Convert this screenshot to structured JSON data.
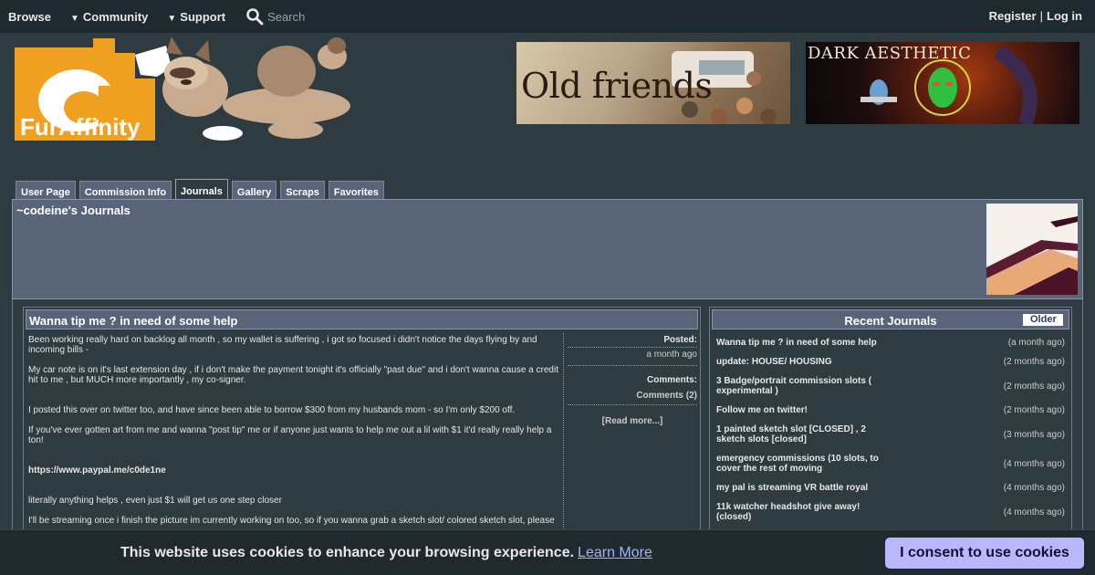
{
  "topnav": {
    "browse": "Browse",
    "community": "Community",
    "support": "Support",
    "search_placeholder": "Search",
    "register": "Register",
    "separator": "|",
    "login": "Log in"
  },
  "header": {
    "logo_text": "FurAffinity",
    "ad1_text": "Old friends",
    "ad2_text": "DARK AESTHETIC"
  },
  "tabs": [
    "User Page",
    "Commission Info",
    "Journals",
    "Gallery",
    "Scraps",
    "Favorites"
  ],
  "active_tab": "Journals",
  "user": {
    "title": "~codeine's Journals"
  },
  "journal": {
    "title": "Wanna tip me ? in need of some help",
    "paragraphs": [
      "Been working really hard on backlog all month , so my wallet is suffering , i got so focused i didn't notice the days flying by and incoming bills -",
      "My car note is on it's last extension day , if i don't make the payment tonight it's officially \"past due\" and i don't wanna cause a credit hit to me , but MUCH more importantly , my co-signer.",
      "I posted this over on twitter too, and have since been able to borrow $300 from my husbands mom - so I'm only $200 off.",
      "If you've ever gotten art from me and wanna \"post tip\" me or if anyone just wants to help me out a lil with $1 it'd really really help a ton!",
      "https://www.paypal.me/c0de1ne",
      "literally anything helps , even just $1 will get us one step closer",
      "I'll be streaming once i finish the picture im currently working on too, so if you wanna grab a sketch slot/ colored sketch slot, please"
    ],
    "posted_label": "Posted:",
    "posted_value": "a month ago",
    "comments_label": "Comments:",
    "comments_value": "Comments (2)",
    "read_more": "[Read more...]"
  },
  "recent": {
    "title": "Recent Journals",
    "older": "Older",
    "items": [
      {
        "title": "Wanna tip me ? in need of some help",
        "date": "(a month ago)"
      },
      {
        "title": "update: HOUSE/ HOUSING",
        "date": "(2 months ago)"
      },
      {
        "title": "3 Badge/portrait commission slots ( experimental )",
        "date": "(2 months ago)"
      },
      {
        "title": "Follow me on twitter!",
        "date": "(2 months ago)"
      },
      {
        "title": "1 painted sketch slot [CLOSED] , 2 sketch slots [closed]",
        "date": "(3 months ago)"
      },
      {
        "title": "emergency commissions (10 slots, to cover the rest of moving",
        "date": "(4 months ago)"
      },
      {
        "title": "my pal is streaming VR battle royal",
        "date": "(4 months ago)"
      },
      {
        "title": "11k watcher headshot give away! (closed)",
        "date": "(4 months ago)"
      }
    ]
  },
  "cookie": {
    "message": "This website uses cookies to enhance your browsing experience.",
    "learn_more": "Learn More",
    "consent": "I consent to use cookies"
  }
}
